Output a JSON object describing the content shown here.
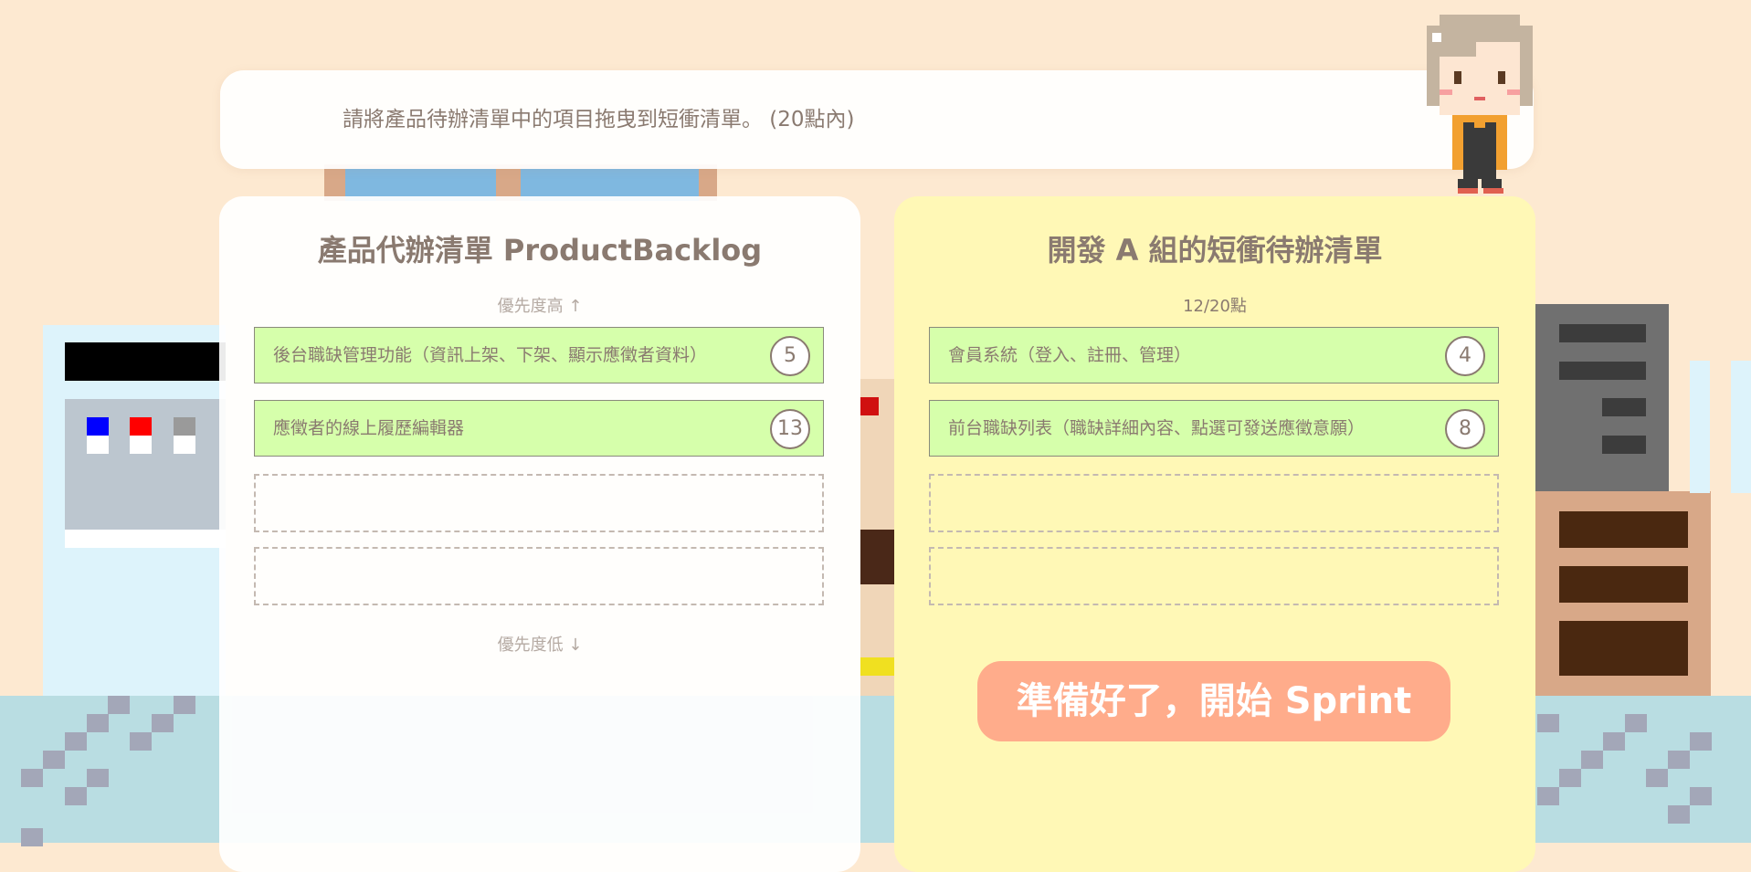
{
  "instruction": {
    "text": "請將產品待辦清單中的項目拖曳到短衝清單。 (20點內)"
  },
  "backlog": {
    "title": "產品代辦清單 ProductBacklog",
    "hint_top": "優先度高 ↑",
    "hint_bottom": "優先度低 ↓",
    "items": [
      {
        "label": "後台職缺管理功能（資訊上架、下架、顯示應徵者資料）",
        "points": "5"
      },
      {
        "label": "應徵者的線上履歷編輯器",
        "points": "13"
      }
    ]
  },
  "sprint": {
    "title": "開發 A 組的短衝待辦清單",
    "points_summary": "12/20點",
    "items": [
      {
        "label": "會員系統（登入、註冊、管理）",
        "points": "4"
      },
      {
        "label": "前台職缺列表（職缺詳細內容、點選可發送應徵意願）",
        "points": "8"
      }
    ],
    "start_button": "準備好了，開始 Sprint"
  },
  "colors": {
    "background": "#fde9d1",
    "card_green": "#d6ffab",
    "sprint_panel": "#fff8b6",
    "start_button": "#ffac8b",
    "text": "#8a7a70"
  },
  "icons": {
    "character": "pixel-character-icon"
  }
}
